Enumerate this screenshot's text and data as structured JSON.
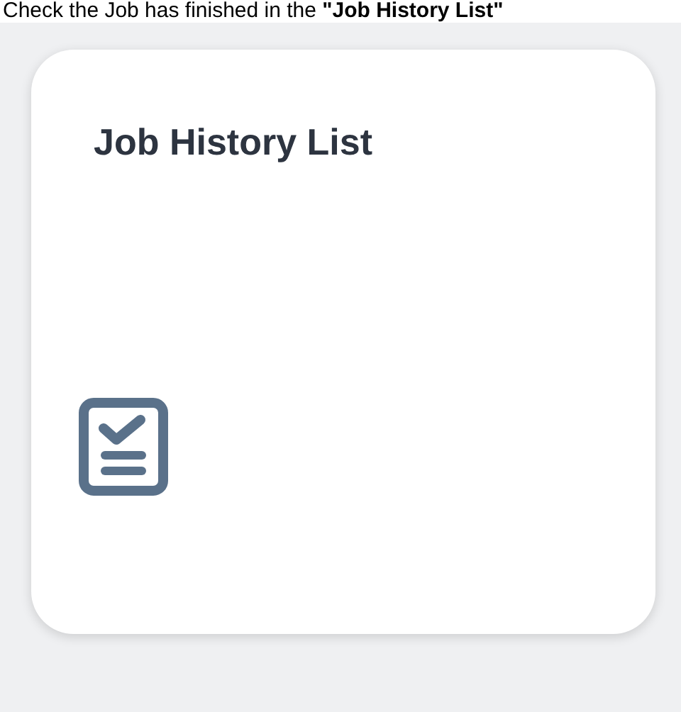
{
  "caption": "Check the Job has finished in the **\"Job History List\"**",
  "card": {
    "title": "Job History List"
  }
}
